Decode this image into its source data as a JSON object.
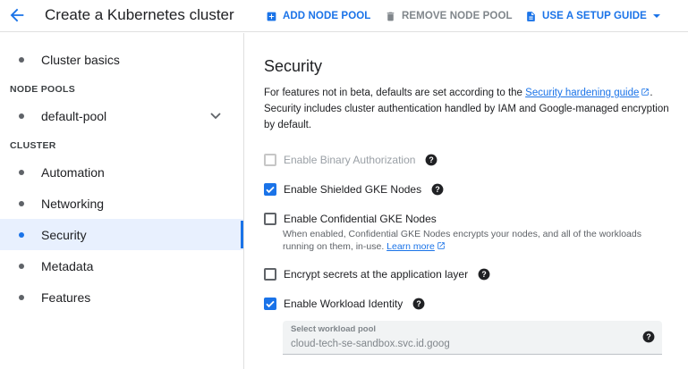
{
  "header": {
    "title": "Create a Kubernetes cluster",
    "add_node_pool": "ADD NODE POOL",
    "remove_node_pool": "REMOVE NODE POOL",
    "setup_guide": "USE A SETUP GUIDE"
  },
  "sidebar": {
    "cluster_basics": "Cluster basics",
    "node_pools_header": "NODE POOLS",
    "default_pool": "default-pool",
    "cluster_header": "CLUSTER",
    "items": [
      "Automation",
      "Networking",
      "Security",
      "Metadata",
      "Features"
    ],
    "active_item": "Security"
  },
  "main": {
    "title": "Security",
    "intro_before_link": "For features not in beta, defaults are set according to the ",
    "intro_link": "Security hardening guide",
    "intro_after_link": ".",
    "intro_line2": "Security includes cluster authentication handled by IAM and Google-managed encryption by default.",
    "options": {
      "binary_auth": {
        "label": "Enable Binary Authorization",
        "checked": false,
        "disabled": true
      },
      "shielded_nodes": {
        "label": "Enable Shielded GKE Nodes",
        "checked": true
      },
      "confidential_nodes": {
        "label": "Enable Confidential GKE Nodes",
        "checked": false,
        "description": "When enabled, Confidential GKE Nodes encrypts your nodes, and all of the workloads running on them, in-use.",
        "learn_more": "Learn more"
      },
      "encrypt_secrets": {
        "label": "Encrypt secrets at the application layer",
        "checked": false
      },
      "workload_identity": {
        "label": "Enable Workload Identity",
        "checked": true
      }
    },
    "workload_pool": {
      "label": "Select workload pool",
      "value": "cloud-tech-se-sandbox.svc.id.goog"
    }
  },
  "colors": {
    "accent": "#1a73e8",
    "active_nav_bg": "#e8f0fe",
    "disabled_text": "#9aa0a6"
  }
}
